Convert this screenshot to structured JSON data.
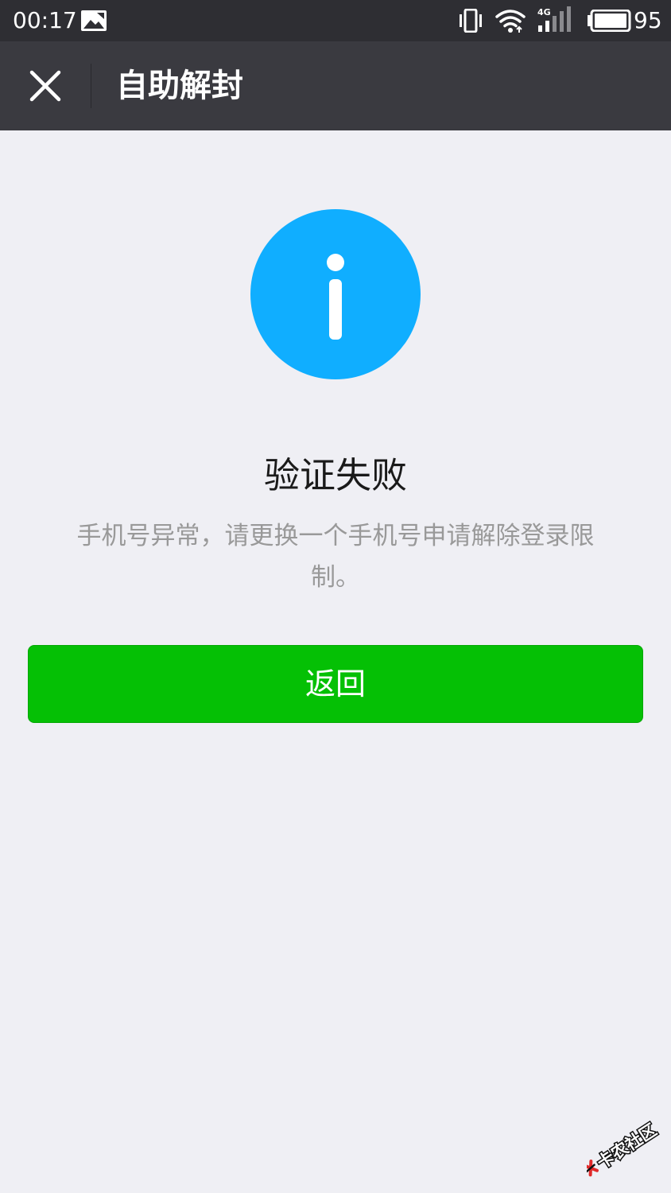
{
  "status_bar": {
    "time": "00:17",
    "network_type": "4G",
    "battery_level": "95",
    "icons": [
      "image-notification-icon",
      "vibrate-icon",
      "wifi-icon",
      "cellular-signal-icon",
      "battery-icon"
    ]
  },
  "nav": {
    "title": "自助解封",
    "close_icon": "close-icon"
  },
  "result": {
    "icon": "info-icon",
    "icon_color": "#10aeff",
    "title": "验证失败",
    "description": "手机号异常，请更换一个手机号申请解除登录限制。"
  },
  "actions": {
    "back_label": "返回",
    "back_color": "#05c005"
  },
  "watermark": {
    "text": "卡农社区",
    "icon": "watermark-logo-icon"
  }
}
